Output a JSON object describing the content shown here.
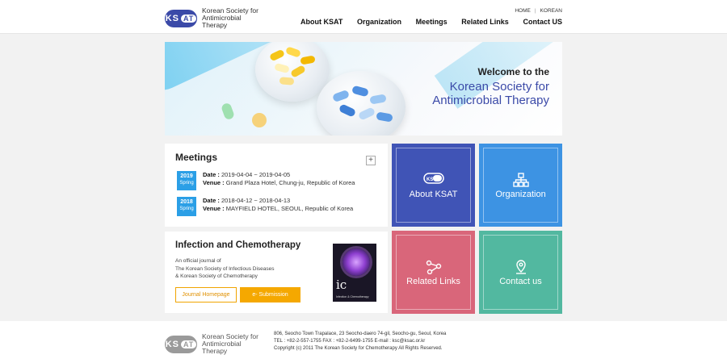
{
  "header": {
    "logo_badge_left": "KS",
    "logo_badge_right": "AT",
    "logo_line1": "Korean Society for",
    "logo_line2": "Antimicrobial Therapy",
    "toplinks": {
      "home": "HOME",
      "separator": "|",
      "korean": "KOREAN"
    },
    "nav": [
      "About KSAT",
      "Organization",
      "Meetings",
      "Related Links",
      "Contact US"
    ]
  },
  "banner": {
    "welcome": "Welcome to the",
    "title_line1": "Korean Society for",
    "title_line2": "Antimicrobial Therapy"
  },
  "meetings": {
    "title": "Meetings",
    "more_icon": "+",
    "items": [
      {
        "year": "2019",
        "season": "Spring",
        "date_label": "Date :",
        "date": "2019-04-04 ~ 2019-04-05",
        "venue_label": "Venue :",
        "venue": "Grand Plaza Hotel, Chung-ju, Republic of Korea"
      },
      {
        "year": "2018",
        "season": "Spring",
        "date_label": "Date :",
        "date": "2018-04-12 ~ 2018-04-13",
        "venue_label": "Venue :",
        "venue": "MAYFIELD HOTEL, SEOUL, Republic of Korea"
      }
    ]
  },
  "journal": {
    "title": "Infection and Chemotherapy",
    "desc_line1": "An official journal of",
    "desc_line2": "The Korean Society of Infectious Diseases",
    "desc_line3": "& Korean Society of Chemotherapy",
    "btn_homepage": "Journal Homepage",
    "btn_submission": "e- Submission",
    "cover_letters": "ic",
    "cover_title": "Infection & Chemotherapy"
  },
  "tiles": [
    {
      "label": "About KSAT",
      "icon": "ksat-logo-icon",
      "color": "#4054b6"
    },
    {
      "label": "Organization",
      "icon": "org-chart-icon",
      "color": "#3d93e3"
    },
    {
      "label": "Related Links",
      "icon": "share-nodes-icon",
      "color": "#d9667a"
    },
    {
      "label": "Contact us",
      "icon": "location-pin-icon",
      "color": "#52b8a0"
    }
  ],
  "footer": {
    "logo_badge_left": "KS",
    "logo_badge_right": "AT",
    "logo_line1": "Korean Society for",
    "logo_line2": "Antimicrobial Therapy",
    "address": "806, Seocho Town Trapalace, 23 Seocho-daero 74-gil, Seocho-gu, Seoul, Korea",
    "contact": "TEL : +82-2-557-1755 FAX : +82-2-6499-1755 E-mail : ksc@ksac.or.kr",
    "copyright": "Copyright (c) 2011 The Korean Society for Chemotherapy All Rights Reserved."
  }
}
